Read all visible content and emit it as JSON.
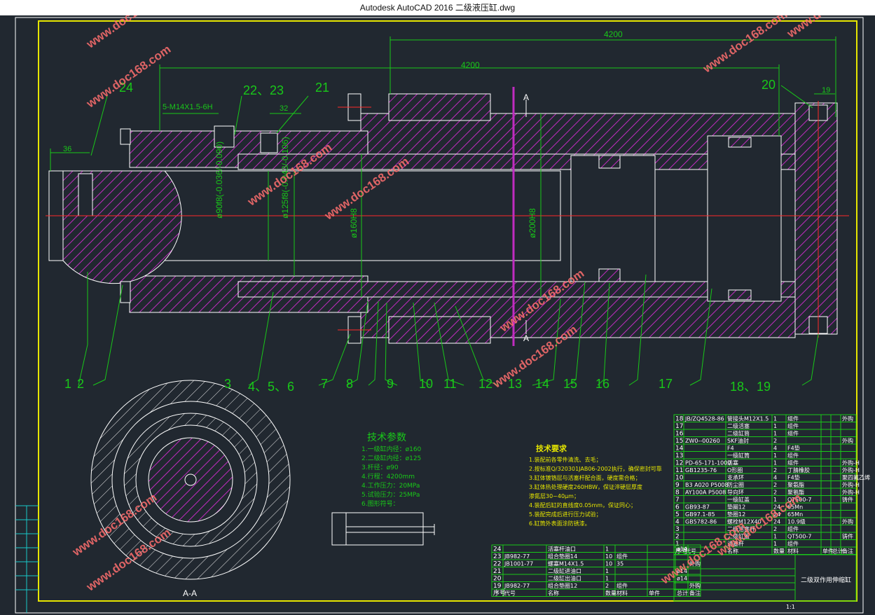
{
  "window": {
    "title": "Autodesk AutoCAD 2016     二级液压缸.dwg"
  },
  "colors": {
    "bg": "#212830",
    "frame": "#e6e600",
    "line": "#ffffff",
    "hatch": "#c02cc0",
    "dim": "#19c819",
    "center": "#ff2a2a",
    "table": "#19c819"
  },
  "dims": {
    "top_length": "4200",
    "mid_length": "4200",
    "left_len": "36",
    "right_len": "19",
    "thread": "5-M14X1.5-6H",
    "len_32": "32",
    "d90": "ø90f8(-0.036/-0.090)",
    "d125": "ø125f8(-0.043/-0.106)",
    "d160": "ø160H8",
    "d200": "ø200H8",
    "section": "A",
    "section_view": "A-A"
  },
  "part_labels": {
    "left_bottom": [
      "1",
      "2",
      "3",
      "4、5、6",
      "7",
      "8",
      "9",
      "10",
      "11",
      "12",
      "13",
      "14",
      "15",
      "16",
      "17",
      "18、19"
    ],
    "top": [
      "24",
      "22、23",
      "21",
      "20"
    ]
  },
  "params": {
    "title": "技术参数",
    "items": [
      "1.一级缸内径：ø160",
      "2.二级缸内径：ø125",
      "3.杆径：ø90",
      "4.行程：4200mm",
      "4.工作压力：20MPa",
      "5.试验压力：25MPa",
      "6.图形符号："
    ]
  },
  "tech_req": {
    "title": "技术要求",
    "items": [
      "1.装配前各零件清洗、去毛；",
      "2.按标准Q/320301JAB06-2002执行，确保密封可靠",
      "3.缸体镀铬层与活塞杆配合面，硬度需合格；",
      "3.缸体热处理硬度260HBW，保证淬硬层厚度",
      "渗氮层30~40μm；",
      "4.装配后缸的直线度0.05mm，保证同心；",
      "5.装配完成后进行压力试验；",
      "6.缸筒外表面涂防锈漆。"
    ]
  },
  "parts_upper": [
    [
      "18",
      "JB/ZQ4528-86",
      "管接头M12X1.5",
      "1",
      "组件",
      "",
      "",
      "外购"
    ],
    [
      "17",
      "",
      "二级活塞",
      "1",
      "组件",
      "",
      "",
      ""
    ],
    [
      "16",
      "",
      "二级缸筒",
      "1",
      "组件",
      "",
      "",
      ""
    ],
    [
      "15",
      "ZW0--00260",
      "SKF油封",
      "2",
      "",
      "",
      "",
      "外购"
    ],
    [
      "14",
      "",
      "F4",
      "4",
      "F4垫",
      "",
      "",
      ""
    ],
    [
      "13",
      "",
      "一级缸筒",
      "1",
      "组件",
      "",
      "",
      ""
    ],
    [
      "12",
      "PD-65-171-1000",
      "活塞",
      "1",
      "组件",
      "",
      "",
      "外购-H"
    ],
    [
      "11",
      "GB1235-76",
      "O形圈",
      "2",
      "丁腈橡胶",
      "",
      "",
      "外购-H"
    ],
    [
      "10",
      "",
      "支承环",
      "4",
      "F4垫",
      "",
      "",
      "聚四氟乙烯"
    ],
    [
      "9",
      "B3 A020 P5008",
      "防尘圈",
      "2",
      "聚氨酯",
      "",
      "",
      "外购-H"
    ],
    [
      "8",
      "AY100A P5008",
      "导向环",
      "2",
      "聚氨酯",
      "",
      "",
      "外购-H"
    ],
    [
      "7",
      "",
      "一级缸盖",
      "1",
      "QT500-7",
      "",
      "",
      "铸件"
    ],
    [
      "6",
      "GB93-87",
      "垫圈12",
      "24",
      "65Mn",
      "",
      "",
      ""
    ],
    [
      "5",
      "GB97.1-85",
      "垫圈12",
      "24",
      "65Mn",
      "",
      "",
      ""
    ],
    [
      "4",
      "GB5782-86",
      "螺栓M12X40",
      "24",
      "10.9级",
      "",
      "",
      "外购"
    ],
    [
      "3",
      "",
      "二级活塞杆",
      "2",
      "组件",
      "",
      "",
      ""
    ],
    [
      "2",
      "",
      "二级缸盖",
      "1",
      "QT500-7",
      "",
      "",
      "铸件"
    ],
    [
      "1",
      "",
      "活塞杆",
      "1",
      "组件",
      "",
      "",
      ""
    ]
  ],
  "parts_upper_header": [
    "序号",
    "代号",
    "名称",
    "数量",
    "材料",
    "单件",
    "总计",
    "备注"
  ],
  "parts_lower": [
    [
      "24",
      "",
      "活塞杆油口",
      "1",
      "",
      "",
      "ø14",
      ""
    ],
    [
      "23",
      "JB982-77",
      "组合垫圈14",
      "10",
      "组件",
      "",
      "",
      ""
    ],
    [
      "22",
      "JB1001-77",
      "螺塞M14X1.5",
      "10",
      "35",
      "",
      "",
      "外购"
    ],
    [
      "21",
      "",
      "二级缸进油口",
      "1",
      "",
      "",
      "ø14",
      ""
    ],
    [
      "20",
      "",
      "二级缸出油口",
      "1",
      "",
      "",
      "ø14",
      ""
    ],
    [
      "19",
      "JB982-77",
      "组合垫圈12",
      "2",
      "组件",
      "",
      "",
      "外购"
    ]
  ],
  "parts_lower_header": [
    "序号",
    "代号",
    "名称",
    "数量",
    "材料",
    "单件",
    "总计",
    "备注"
  ],
  "title_block": {
    "name": "二级双作用伸缩缸",
    "scale": "1:1"
  },
  "watermark": "www.doc168.com"
}
